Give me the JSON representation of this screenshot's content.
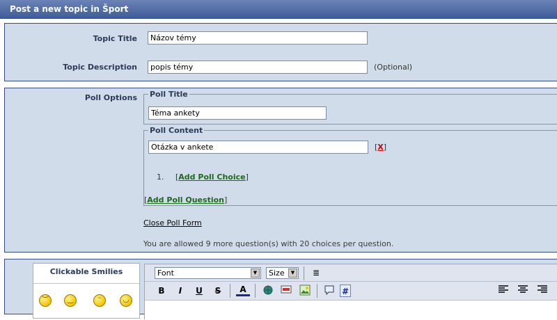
{
  "header": {
    "title": "Post a new topic in Šport"
  },
  "topic": {
    "title_label": "Topic Title",
    "title_value": "Názov témy",
    "desc_label": "Topic Description",
    "desc_value": "popis témy",
    "desc_note": "(Optional)"
  },
  "poll": {
    "options_label": "Poll Options",
    "title_legend": "Poll Title",
    "title_value": "Téma ankety",
    "content_legend": "Poll Content",
    "question_value": "Otázka v ankete",
    "remove_label": "X",
    "choice_number": "1.",
    "add_choice_label": "Add Poll Choice",
    "add_question_label": "Add Poll Question",
    "close_label": "Close Poll Form",
    "allowance_text": "You are allowed 9 more question(s) with 20 choices per question."
  },
  "smilies": {
    "title": "Clickable Smilies"
  },
  "editor": {
    "font_select": "Font",
    "size_select": "Size",
    "bold": "B",
    "italic": "I",
    "underline": "U",
    "strike": "S",
    "color": "A",
    "code": "#"
  }
}
